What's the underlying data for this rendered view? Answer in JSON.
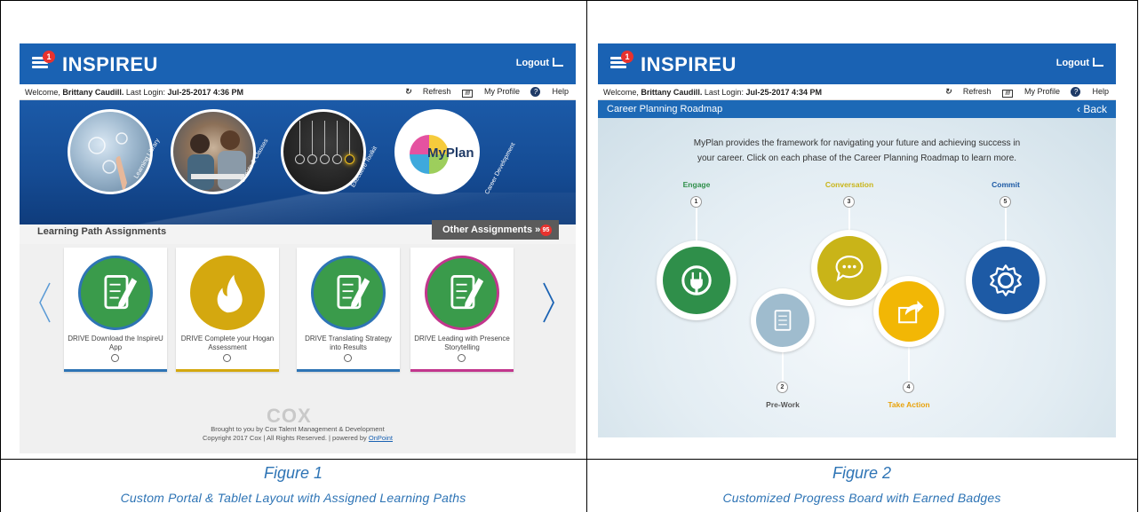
{
  "figure1": {
    "logo": "INSPIREU",
    "notification_count": "1",
    "logout_label": "Logout",
    "welcome_prefix": "Welcome,",
    "user_name": "Brittany Caudill.",
    "last_login_label": "Last Login:",
    "last_login_value": "Jul-25-2017 4:36 PM",
    "tools": {
      "refresh": "Refresh",
      "profile": "My Profile",
      "help": "Help"
    },
    "tiles": [
      {
        "label": "Learning Library"
      },
      {
        "label": "Events & Classes"
      },
      {
        "label": "Executive Toolkit"
      },
      {
        "label": "Career Development",
        "logo_text": "MyPlan"
      }
    ],
    "section_title": "Learning Path Assignments",
    "other_assignments_label": "Other Assignments »",
    "other_assignments_count": "95",
    "cards": [
      {
        "title": "DRIVE Download the InspireU App",
        "icon": "notepad-icon",
        "color": "#3a9b4b",
        "ring": "#2e74b5"
      },
      {
        "title": "DRIVE Complete your Hogan Assessment",
        "icon": "flame-icon",
        "color": "#d4a80f",
        "ring": "#d4a80f"
      },
      {
        "title": "DRIVE Translating Strategy into Results",
        "icon": "notepad-icon",
        "color": "#3a9b4b",
        "ring": "#2e74b5"
      },
      {
        "title": "DRIVE Leading with Presence Storytelling",
        "icon": "notepad-icon",
        "color": "#3a9b4b",
        "ring": "#c2368d"
      }
    ],
    "footer_logo": "COX",
    "footer_line1": "Brought to you by Cox Talent Management & Development",
    "footer_line2_prefix": "Copyright 2017 Cox | All Rights Reserved. | powered by",
    "footer_link": "OnPoint"
  },
  "figure2": {
    "logo": "INSPIREU",
    "notification_count": "1",
    "logout_label": "Logout",
    "welcome_prefix": "Welcome,",
    "user_name": "Brittany Caudill.",
    "last_login_label": "Last Login:",
    "last_login_value": "Jul-25-2017 4:34 PM",
    "tools": {
      "refresh": "Refresh",
      "profile": "My Profile",
      "help": "Help"
    },
    "page_title": "Career Planning Roadmap",
    "back_label": "‹ Back",
    "intro_line1": "MyPlan provides the framework for navigating your future and achieving success in",
    "intro_line2": "your career. Click on each phase of the Career Planning Roadmap to learn more.",
    "phases": [
      {
        "number": "1",
        "label": "Engage",
        "color": "#2f8f4a",
        "label_color": "#2f8f4a",
        "icon": "plug-icon"
      },
      {
        "number": "2",
        "label": "Pre-Work",
        "color": "#9fbcce",
        "label_color": "#555555",
        "icon": "document-icon"
      },
      {
        "number": "3",
        "label": "Conversation",
        "color": "#c9b418",
        "label_color": "#c9b418",
        "icon": "chat-icon"
      },
      {
        "number": "4",
        "label": "Take Action",
        "color": "#f2b705",
        "label_color": "#e8a20c",
        "icon": "share-icon"
      },
      {
        "number": "5",
        "label": "Commit",
        "color": "#1d5aa5",
        "label_color": "#1d5aa5",
        "icon": "gear-icon"
      }
    ]
  },
  "captions": {
    "fig1_title": "Figure 1",
    "fig1_sub": "Custom Portal & Tablet Layout with Assigned Learning Paths",
    "fig2_title": "Figure 2",
    "fig2_sub": "Customized Progress Board with Earned Badges"
  }
}
